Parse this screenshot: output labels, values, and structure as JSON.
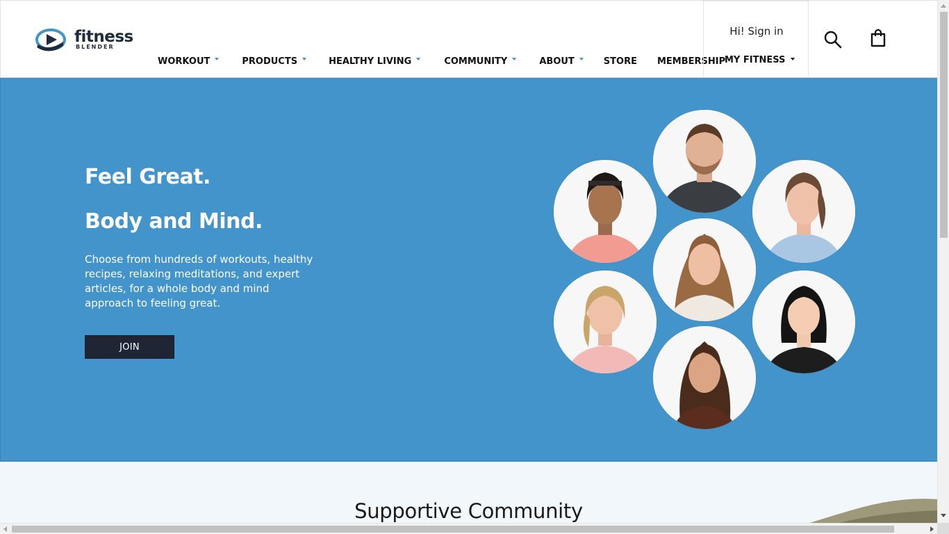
{
  "brand": {
    "name": "fitness",
    "sub": "BLENDER",
    "logo_icon": "play-swoosh-icon",
    "colors": {
      "blue": "#4394cb",
      "dark": "#1f2a3a"
    }
  },
  "nav": {
    "items": [
      {
        "label": "WORKOUT",
        "has_dropdown": true
      },
      {
        "label": "PRODUCTS",
        "has_dropdown": true
      },
      {
        "label": "HEALTHY LIVING",
        "has_dropdown": true
      },
      {
        "label": "COMMUNITY",
        "has_dropdown": true
      },
      {
        "label": "ABOUT",
        "has_dropdown": true
      },
      {
        "label": "STORE",
        "has_dropdown": false
      },
      {
        "label": "MEMBERSHIP",
        "has_dropdown": false
      }
    ]
  },
  "account": {
    "signin_label": "Hi! Sign in",
    "myfitness_label": "MY FITNESS"
  },
  "header_icons": {
    "search": "search-icon",
    "cart": "shopping-bag-icon"
  },
  "hero": {
    "title_line1": "Feel Great.",
    "title_line2": "Body and Mind.",
    "description": "Choose from hundreds of workouts, healthy recipes, relaxing meditations, and expert articles, for a whole body and mind approach to feeling great.",
    "join_label": "JOIN",
    "background": "#4394cb",
    "trainer_photos": 7
  },
  "community": {
    "title": "Supportive Community"
  }
}
